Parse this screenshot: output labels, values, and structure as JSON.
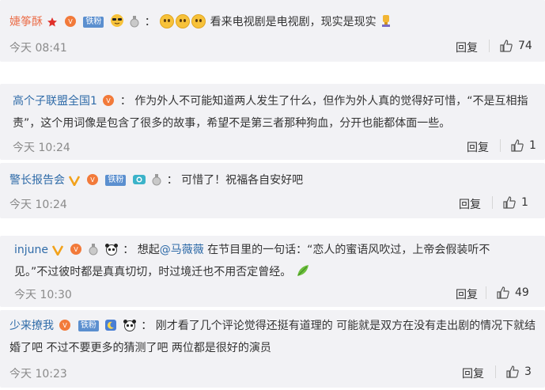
{
  "comments": [
    {
      "user": "婕筝酥",
      "fan_badge": "铁粉",
      "separator": "：",
      "text": "看来电视剧是电视剧，现实是现实",
      "time": "今天 08:41",
      "reply": "回复",
      "likes": "74"
    },
    {
      "user": "高个子联盟全国1",
      "separator": "：",
      "text": "作为外人不可能知道两人发生了什么，但作为外人真的觉得好可惜，“不是互相指责”，这个用词像是包含了很多的故事，希望不是第三者那种狗血，分开也能都体面一些。",
      "time": "今天 10:24",
      "reply": "回复",
      "likes": "1"
    },
    {
      "user": "警长报告会",
      "fan_badge": "铁粉",
      "separator": "：",
      "text": "可惜了！祝福各自安好吧",
      "time": "今天 10:24",
      "reply": "回复",
      "likes": "1"
    },
    {
      "user": "injune",
      "separator": "：",
      "text_before": "想起",
      "mention": "@马薇薇",
      "text_after": " 在节目里的一句话：“恋人的蜜语风吹过，上帝会假装听不见。”不过彼时都是真真切切，时过境迁也不用否定曾经。",
      "time": "今天 10:30",
      "reply": "回复",
      "likes": "49"
    },
    {
      "user": "少来撩我",
      "fan_badge": "铁粉",
      "separator": "：",
      "text": "刚才看了几个评论觉得还挺有道理的 可能就是双方在没有走出剧的情况下就结婚了吧 不过不要更多的猜测了吧 两位都是很好的演员",
      "time": "今天 10:23",
      "reply": "回复",
      "likes": "3"
    }
  ]
}
